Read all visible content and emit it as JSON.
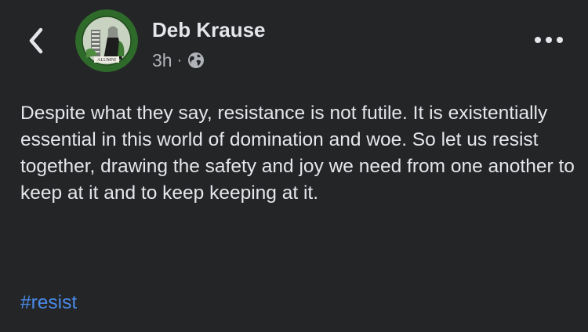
{
  "header": {
    "back_icon": "chevron-left-icon",
    "author_name": "Deb Krause",
    "timestamp": "3h",
    "separator": "·",
    "audience_icon": "globe-icon",
    "more_icon": "more-horizontal-icon",
    "avatar_caption": "ALUMNI"
  },
  "post": {
    "text": "Despite what they say, resistance is not futile. It is existentially essential in this world of domination and woe. So let us resist together, drawing the safety and joy we need from one another to keep at it and to keep keeping at it.",
    "hashtag": "#resist"
  },
  "colors": {
    "background": "#242526",
    "primary_text": "#e4e6eb",
    "secondary_text": "#b0b3b8",
    "link": "#4a8ae8",
    "avatar_ring": "#2e6b2a"
  }
}
